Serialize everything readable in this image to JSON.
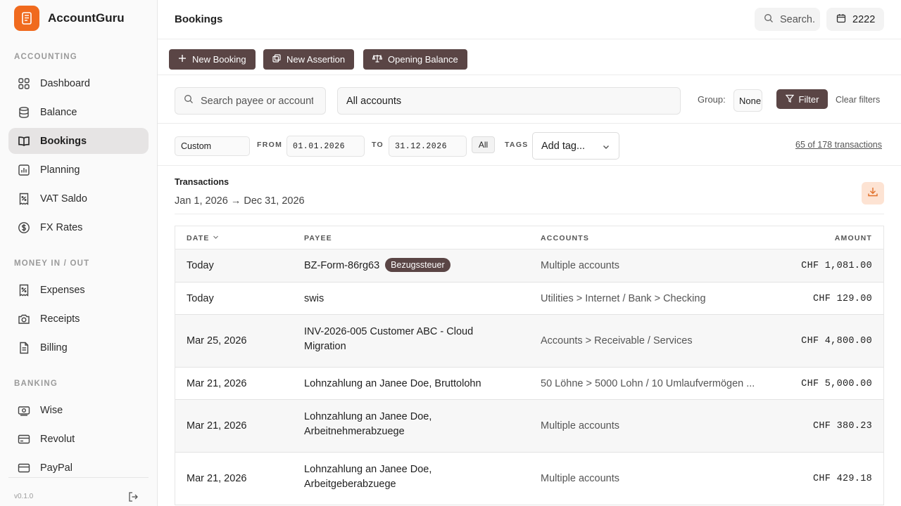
{
  "brand": {
    "name": "AccountGuru",
    "color": "#f06a1e"
  },
  "sidebar": {
    "sections": [
      {
        "label": "ACCOUNTING"
      },
      {
        "label": "MONEY IN / OUT"
      },
      {
        "label": "BANKING"
      }
    ],
    "items": [
      {
        "label": "Dashboard",
        "icon": "dashboard-icon"
      },
      {
        "label": "Balance",
        "icon": "database-icon"
      },
      {
        "label": "Bookings",
        "icon": "book-icon",
        "active": true
      },
      {
        "label": "Planning",
        "icon": "chart-icon"
      },
      {
        "label": "VAT Saldo",
        "icon": "receipt-percent-icon"
      },
      {
        "label": "FX Rates",
        "icon": "dollar-circle-icon"
      },
      {
        "label": "Expenses",
        "icon": "receipt-percent-icon"
      },
      {
        "label": "Receipts",
        "icon": "camera-icon"
      },
      {
        "label": "Billing",
        "icon": "document-icon"
      },
      {
        "label": "Wise",
        "icon": "banknote-icon"
      },
      {
        "label": "Revolut",
        "icon": "credit-card-icon"
      },
      {
        "label": "PayPal",
        "icon": "credit-card-icon"
      }
    ],
    "version": "v0.1.0"
  },
  "header": {
    "title": "Bookings",
    "search_label": "Search.",
    "year": "2222"
  },
  "actions": {
    "new_booking": "New Booking",
    "new_assertion": "New Assertion",
    "opening_balance": "Opening Balance"
  },
  "filters": {
    "search_placeholder": "Search payee or account",
    "accounts": "All accounts",
    "group_label": "Group:",
    "group_value": "None",
    "filter_label": "Filter",
    "clear_label": "Clear filters",
    "period": "Custom",
    "from_label": "FROM",
    "from": "01.01.2026",
    "to_label": "TO",
    "to": "31.12.2026",
    "all_label": "All",
    "tags_label": "TAGS",
    "tag_placeholder": "Add tag...",
    "count": "65 of 178 transactions"
  },
  "transactions": {
    "title": "Transactions",
    "range": "Jan 1, 2026 → Dec 31, 2026",
    "columns": {
      "date": "DATE",
      "payee": "PAYEE",
      "accounts": "ACCOUNTS",
      "amount": "AMOUNT"
    },
    "rows": [
      {
        "date": "Today",
        "payee": "BZ-Form-86rg63",
        "badge": "Bezugssteuer",
        "accounts": "Multiple accounts",
        "amount": "CHF 1,081.00"
      },
      {
        "date": "Today",
        "payee": "swis",
        "accounts": "Utilities > Internet / Bank > Checking",
        "amount": "CHF 129.00"
      },
      {
        "date": "Mar 25, 2026",
        "payee": "INV-2026-005 Customer ABC - Cloud Migration",
        "accounts": "Accounts > Receivable / Services",
        "amount": "CHF 4,800.00"
      },
      {
        "date": "Mar 21, 2026",
        "payee": "Lohnzahlung an Janee Doe, Bruttolohn",
        "accounts": "50 Löhne > 5000 Lohn / 10 Umlaufvermögen ...",
        "amount": "CHF 5,000.00"
      },
      {
        "date": "Mar 21, 2026",
        "payee": "Lohnzahlung an Janee Doe, Arbeitnehmerabzuege",
        "accounts": "Multiple accounts",
        "amount": "CHF 380.23"
      },
      {
        "date": "Mar 21, 2026",
        "payee": "Lohnzahlung an Janee Doe, Arbeitgeberabzuege",
        "accounts": "Multiple accounts",
        "amount": "CHF 429.18"
      }
    ]
  },
  "colors": {
    "accent_dark": "#5a4545",
    "brand_orange": "#f06a1e",
    "download_bg": "#fde3d3"
  }
}
